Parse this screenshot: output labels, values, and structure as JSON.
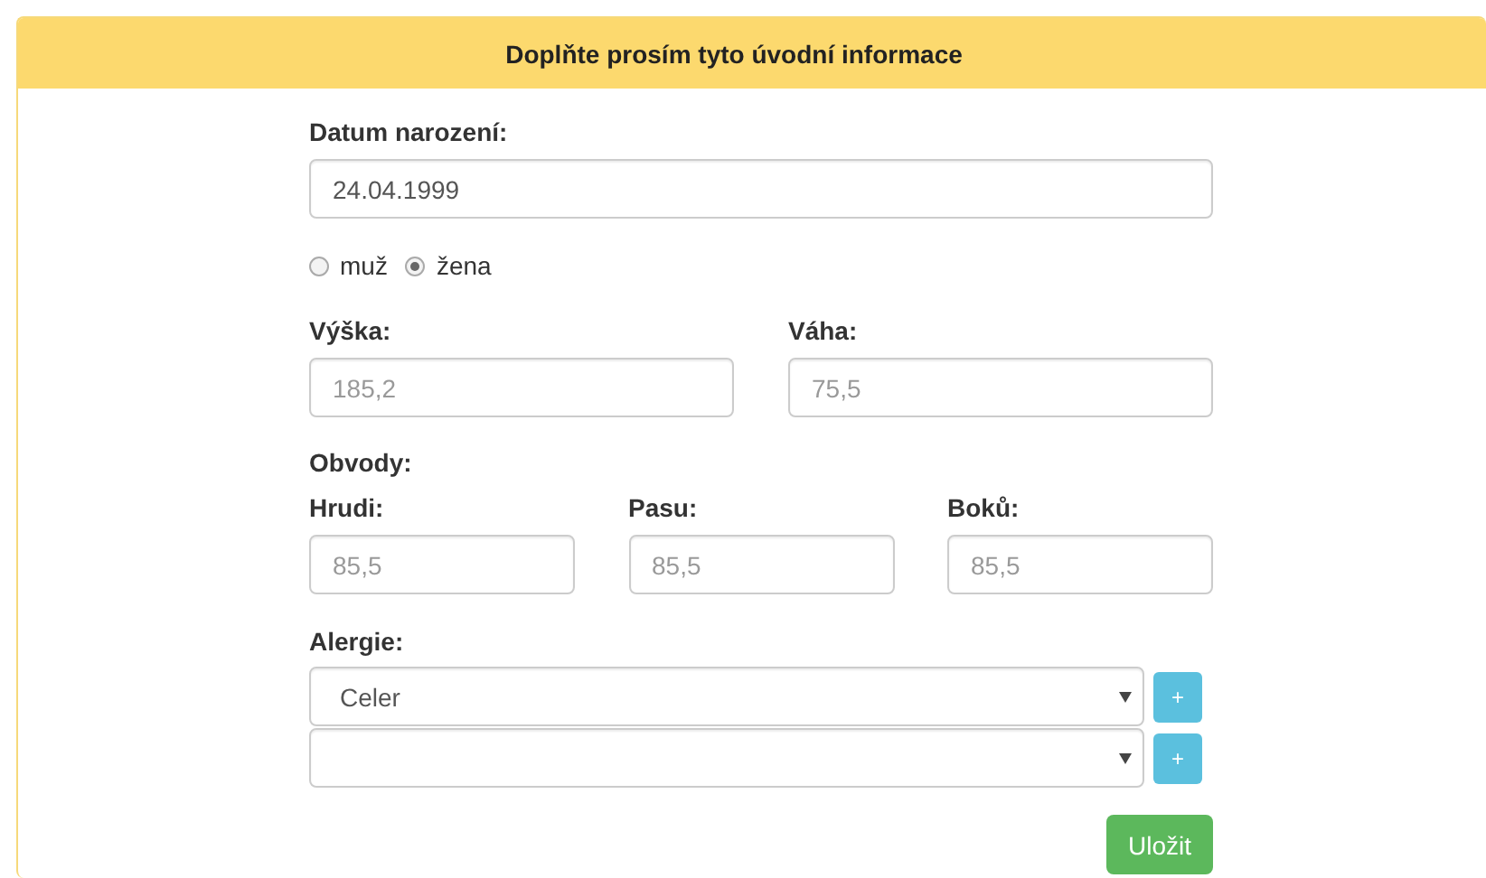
{
  "header": {
    "title": "Doplňte prosím tyto úvodní informace"
  },
  "birth_date": {
    "label": "Datum narození:",
    "value": "24.04.1999"
  },
  "sex": [
    {
      "label": "muž",
      "selected": false
    },
    {
      "label": "žena",
      "selected": true
    }
  ],
  "height": {
    "label": "Výška:",
    "placeholder": "185,2"
  },
  "weight": {
    "label": "Váha:",
    "placeholder": "75,5"
  },
  "circumferences": {
    "label": "Obvody:",
    "fields": [
      {
        "label": "Hrudi:",
        "placeholder": "85,5"
      },
      {
        "label": "Pasu:",
        "placeholder": "85,5"
      },
      {
        "label": "Boků:",
        "placeholder": "85,5"
      }
    ]
  },
  "allergies": {
    "label": "Alergie:",
    "rows": [
      {
        "value": "Celer",
        "add_button": "+"
      },
      {
        "add_button": "+"
      }
    ]
  },
  "save_button": "Uložit"
}
